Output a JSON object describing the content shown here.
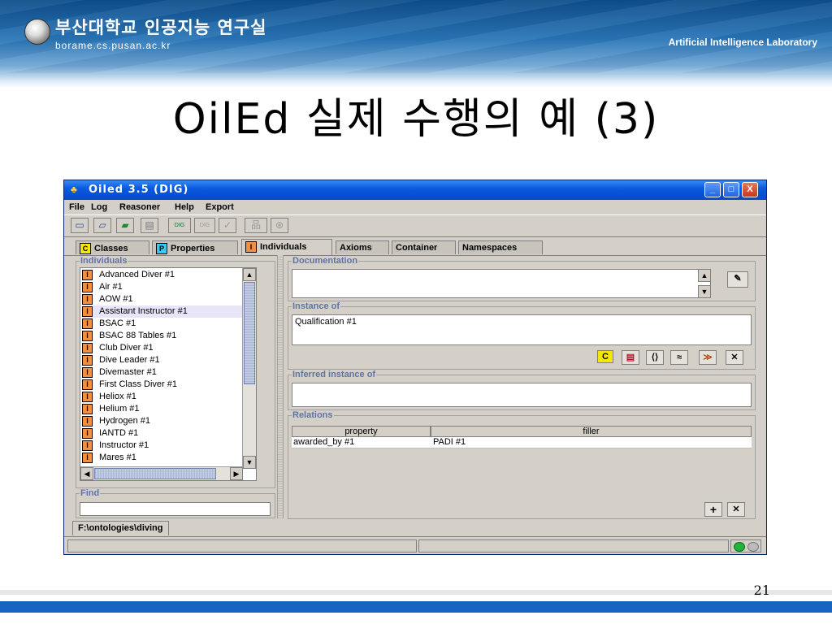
{
  "slide": {
    "university_korean": "부산대학교 인공지능 연구실",
    "domain": "borame.cs.pusan.ac.kr",
    "lab_name": "Artificial Intelligence Laboratory",
    "title": "OilEd 실제 수행의 예 (3)",
    "page_number": "21",
    "colors": {
      "banner": "#1c5fa3",
      "footer_blue": "#1565c0",
      "footer_gray": "#e0e0e0"
    }
  },
  "app": {
    "window_title": "Oiled 3.5 (DIG)",
    "window_buttons": {
      "minimize": "_",
      "maximize": "□",
      "close": "X"
    },
    "menu": [
      {
        "label": "File"
      },
      {
        "label": "Log"
      },
      {
        "label": "Reasoner"
      },
      {
        "label": "Help"
      },
      {
        "label": "Export"
      }
    ],
    "toolbar_icons": [
      "new-folder-icon",
      "open-folder-icon",
      "open-green-folder-icon",
      "save-icon",
      "dig-icon",
      "dig-disabled-icon",
      "check-icon",
      "hierarchy-icon",
      "reasoner-icon"
    ],
    "toolbar_labels": {
      "dig": "DIG",
      "dig2": "DIG",
      "check": "✓",
      "hierarchy": "品",
      "reasoner": "⊛"
    },
    "tabs": [
      {
        "label": "Classes",
        "badge": "C"
      },
      {
        "label": "Properties",
        "badge": "P"
      },
      {
        "label": "Individuals",
        "badge": "I"
      },
      {
        "label": "Axioms"
      },
      {
        "label": "Container"
      },
      {
        "label": "Namespaces"
      }
    ],
    "individuals_panel": {
      "label": "Individuals",
      "badge": "I",
      "items": [
        "Advanced Diver #1",
        "Air #1",
        "AOW #1",
        "Assistant Instructor #1",
        "BSAC #1",
        "BSAC 88 Tables #1",
        "Club Diver #1",
        "Dive Leader #1",
        "Divemaster #1",
        "First Class Diver #1",
        "Heliox #1",
        "Helium #1",
        "Hydrogen #1",
        "IANTD #1",
        "Instructor #1",
        "Mares #1"
      ],
      "selected_item": "Assistant Instructor #1",
      "find_label": "Find",
      "find_value": ""
    },
    "documentation": {
      "label": "Documentation",
      "value": ""
    },
    "instance_of": {
      "label": "Instance of",
      "value": "Qualification #1",
      "buttons": [
        "C",
        "▤",
        "⟨⟩",
        "≈",
        "≫",
        "✕"
      ]
    },
    "inferred_instance_of": {
      "label": "Inferred instance of",
      "value": ""
    },
    "relations": {
      "label": "Relations",
      "columns": [
        "property",
        "filler"
      ],
      "rows": [
        [
          "awarded_by #1",
          "PADI #1"
        ]
      ],
      "add_button": "+",
      "remove_button": "✕"
    },
    "file_tab": "F:\\ontologies\\diving",
    "status_indicator": "green-status-icon"
  }
}
